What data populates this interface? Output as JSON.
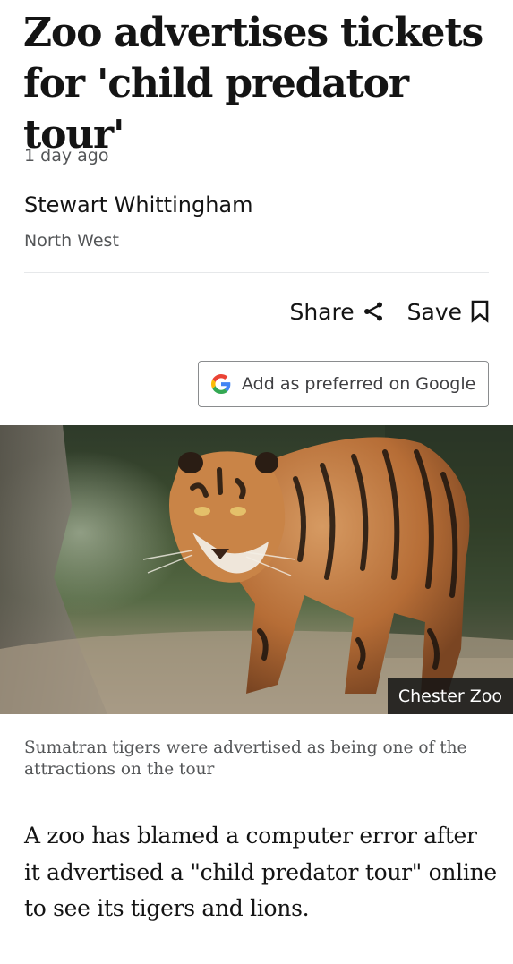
{
  "article": {
    "headline": "Zoo advertises tickets for 'child predator tour'",
    "timestamp": "1 day ago",
    "author": "Stewart Whittingham",
    "author_region": "North West"
  },
  "actions": {
    "share_label": "Share",
    "save_label": "Save",
    "share_icon": "share-icon",
    "save_icon": "bookmark-icon"
  },
  "google_button": {
    "label": "Add as preferred on Google",
    "icon": "google-g-icon"
  },
  "image": {
    "credit": "Chester Zoo",
    "caption": "Sumatran tigers were advertised as being one of the attractions on the tour"
  },
  "body": {
    "paragraph_1": "A zoo has blamed a computer error after it advertised a \"child predator tour\" online to see its tigers and lions."
  },
  "colors": {
    "text_primary": "#141414",
    "text_secondary": "#545658",
    "divider": "#e6e8ea",
    "google_blue": "#4285F4",
    "google_red": "#EA4335",
    "google_yellow": "#FBBC05",
    "google_green": "#34A853"
  }
}
